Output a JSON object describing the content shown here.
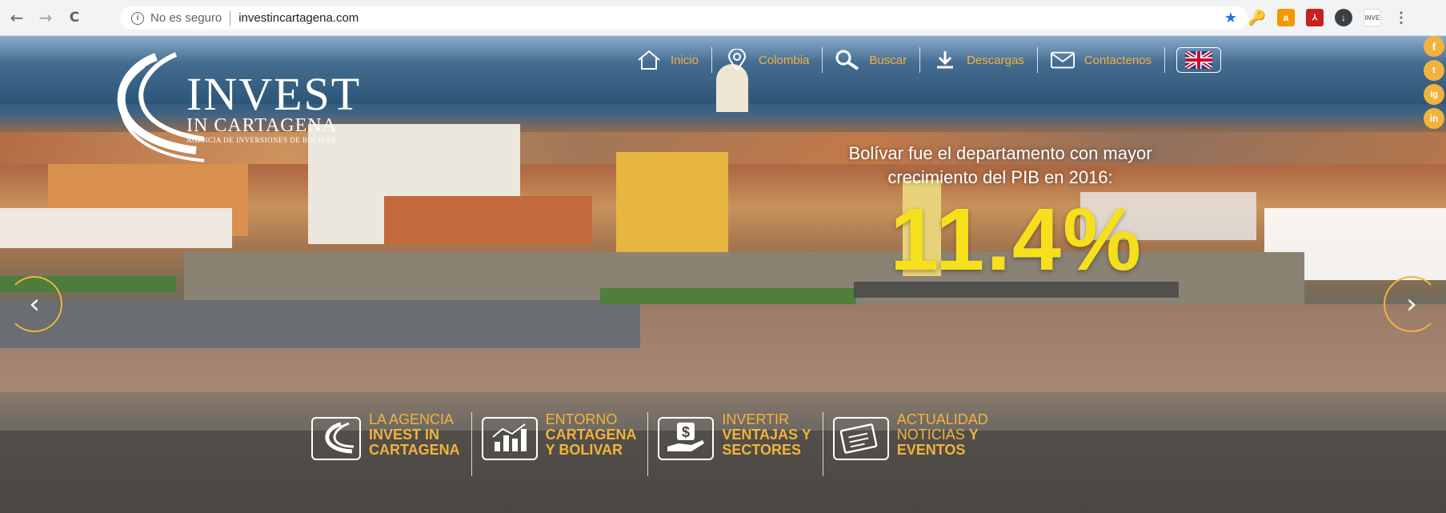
{
  "browser": {
    "back": "←",
    "forward": "→",
    "reload": "C",
    "info_glyph": "i",
    "insecure_label": "No es seguro",
    "url": "investincartagena.com",
    "bookmark_star": "★"
  },
  "logo": {
    "title": "INVEST",
    "subtitle": "IN CARTAGENA",
    "tagline": "AGENCIA DE INVERSIONES DE BOLIVAR"
  },
  "nav": {
    "items": [
      {
        "label": "Inicio",
        "icon": "home-icon"
      },
      {
        "label": "Colombia",
        "icon": "location-pin-icon"
      },
      {
        "label": "Buscar",
        "icon": "search-icon"
      },
      {
        "label": "Descargas",
        "icon": "download-icon"
      },
      {
        "label": "Contactenos",
        "icon": "mail-icon"
      }
    ],
    "language_flag": "uk-flag-icon"
  },
  "social": [
    "f",
    "t",
    "ig",
    "in"
  ],
  "hero": {
    "headline_line1": "Bolívar fue el departamento con mayor",
    "headline_line2": "crecimiento del PIB en 2016:",
    "stat": "11.4%"
  },
  "features": [
    {
      "line1": "LA AGENCIA",
      "line2": "INVEST IN",
      "line3": "CARTAGENA",
      "icon": "agency-logo-icon"
    },
    {
      "line1": "ENTORNO",
      "line2": "CARTAGENA",
      "line3": "Y BOLIVAR",
      "icon": "bar-chart-icon"
    },
    {
      "line1": "INVERTIR",
      "line2": "VENTAJAS Y",
      "line3": "SECTORES",
      "icon": "money-hand-icon"
    },
    {
      "line1": "ACTUALIDAD",
      "line2": "NOTICIAS",
      "line2b": "Y",
      "line3": "EVENTOS",
      "icon": "newspaper-icon"
    }
  ],
  "colors": {
    "accent": "#f2b33d",
    "stat": "#f6e01b"
  }
}
